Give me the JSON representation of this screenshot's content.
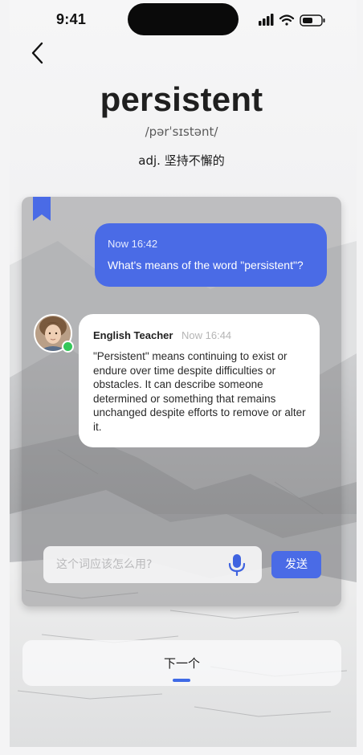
{
  "status_bar": {
    "time": "9:41"
  },
  "word": {
    "text": "persistent",
    "phonetic": "/pərˈsɪstənt/",
    "definition": "adj. 坚持不懈的"
  },
  "chat": {
    "user_message": {
      "timestamp": "Now 16:42",
      "text": "What's means of the word \"persistent\"?"
    },
    "bot_message": {
      "sender": "English Teacher",
      "timestamp": "Now 16:44",
      "text": "\"Persistent\" means continuing to exist or endure over time despite difficulties or obstacles. It can describe someone determined or something that remains unchanged despite efforts to remove or alter it."
    },
    "input": {
      "placeholder": "这个词应该怎么用?",
      "value": ""
    },
    "send_label": "发送"
  },
  "next_button": {
    "label": "下一个"
  },
  "colors": {
    "accent": "#4a6be6",
    "online": "#34c759",
    "text_primary": "#1f1f1f"
  },
  "icons": {
    "back": "chevron-left-icon",
    "bookmark": "bookmark-icon",
    "mic": "microphone-icon",
    "signal": "signal-icon",
    "wifi": "wifi-icon",
    "battery": "battery-icon"
  }
}
